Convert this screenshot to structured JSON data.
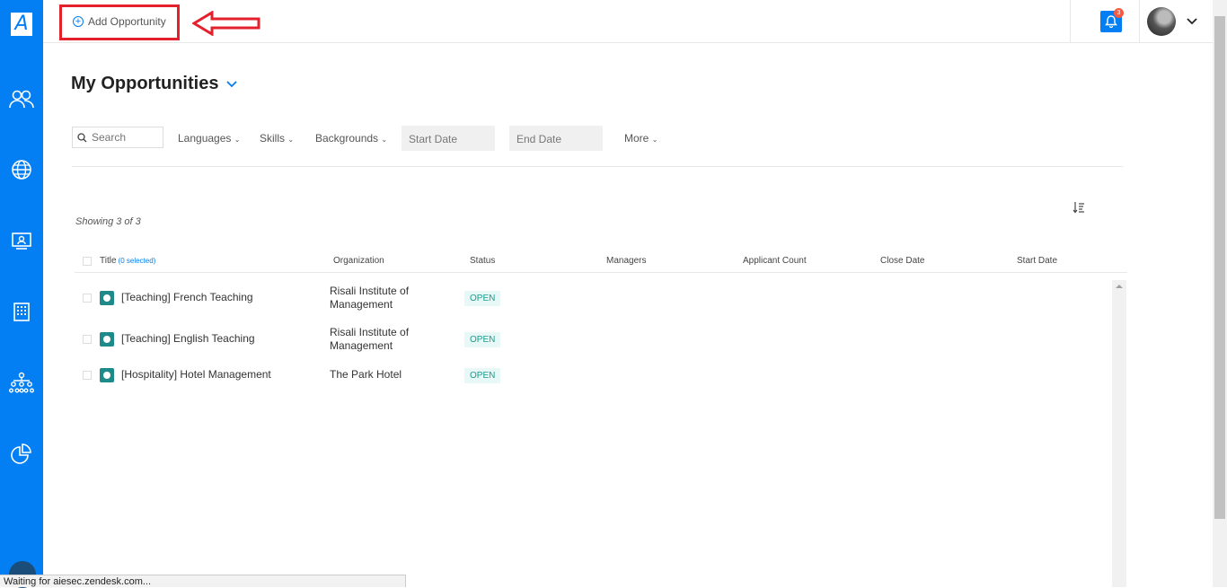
{
  "sidebar": {
    "logo": "A",
    "icons": [
      "people-icon",
      "globe-icon",
      "monitor-user-icon",
      "building-icon",
      "hierarchy-icon",
      "pie-chart-icon"
    ]
  },
  "topbar": {
    "add_opportunity_label": "Add Opportunity",
    "notification_count": "3"
  },
  "page": {
    "title": "My Opportunities"
  },
  "filters": {
    "search_placeholder": "Search",
    "languages": "Languages",
    "skills": "Skills",
    "backgrounds": "Backgrounds",
    "start_date": "Start Date",
    "end_date": "End Date",
    "more": "More"
  },
  "results": {
    "showing": "Showing 3 of 3"
  },
  "table": {
    "headers": {
      "title": "Title",
      "selected": "(0 selected)",
      "organization": "Organization",
      "status": "Status",
      "managers": "Managers",
      "applicant_count": "Applicant Count",
      "close_date": "Close Date",
      "start_date": "Start Date"
    },
    "rows": [
      {
        "title": "[Teaching] French Teaching",
        "organization": "Risali Institute of Management",
        "status": "OPEN"
      },
      {
        "title": "[Teaching] English Teaching",
        "organization": "Risali Institute of Management",
        "status": "OPEN"
      },
      {
        "title": "[Hospitality] Hotel Management",
        "organization": "The Park Hotel",
        "status": "OPEN"
      }
    ]
  },
  "browser_status": "Waiting for aiesec.zendesk.com..."
}
